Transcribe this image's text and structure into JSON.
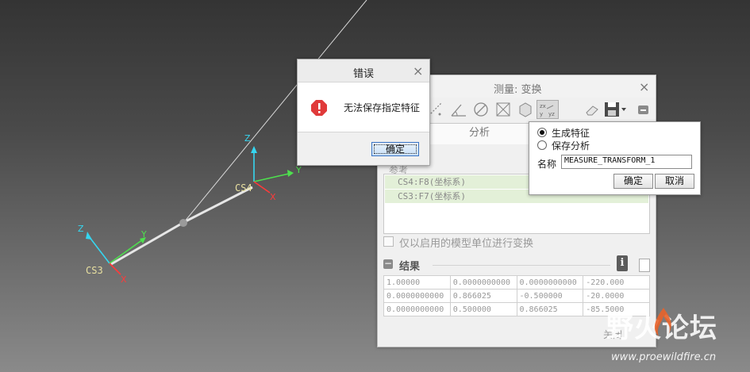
{
  "viewport": {
    "cs3_label": "CS3",
    "cs4_label": "CS4",
    "axis_x": "X",
    "axis_y": "Y",
    "axis_z": "Z"
  },
  "measure_dialog": {
    "title": "测量: 变换",
    "close": "×",
    "tab": "分析",
    "references_label": "参考",
    "references": [
      "CS4:F8(坐标系)",
      "CS3:F7(坐标系)"
    ],
    "checkbox_label": "仅以启用的模型单位进行变换",
    "results_label": "结果",
    "collapse": "−",
    "info_icon_glyph": "i",
    "matrix": [
      [
        "1.00000",
        "0.0000000000",
        "0.0000000000",
        "-220.000"
      ],
      [
        "0.0000000000",
        "0.866025",
        "-0.500000",
        "-20.0000"
      ],
      [
        "0.0000000000",
        "0.500000",
        "0.866025",
        "-85.5000"
      ]
    ],
    "close_button": "关闭",
    "toolbar_icons": [
      "distance-icon",
      "length-icon",
      "angle-icon",
      "diameter-icon",
      "area-icon",
      "volume-icon",
      "transform-icon",
      "eraser-icon",
      "save-icon",
      "collapse-icon"
    ]
  },
  "feature_popup": {
    "option_generate": "生成特征",
    "option_save": "保存分析",
    "selected": "生成特征",
    "name_label": "名称",
    "name_value": "MEASURE_TRANSFORM_1",
    "ok": "确定",
    "cancel": "取消"
  },
  "error_dialog": {
    "title": "错误",
    "close": "×",
    "message": "无法保存指定特征",
    "ok": "确定",
    "icon": "error-exclamation-icon"
  },
  "watermark": {
    "text": "野火论坛",
    "url": "www.proewildfire.cn"
  },
  "colors": {
    "error_red": "#e03a3a",
    "selection_green": "#e3f0d8",
    "csys_label": "#e8e0a0",
    "axis_cyan": "#36d6f0",
    "axis_green": "#4ee04e",
    "axis_red": "#ff3a3a"
  }
}
